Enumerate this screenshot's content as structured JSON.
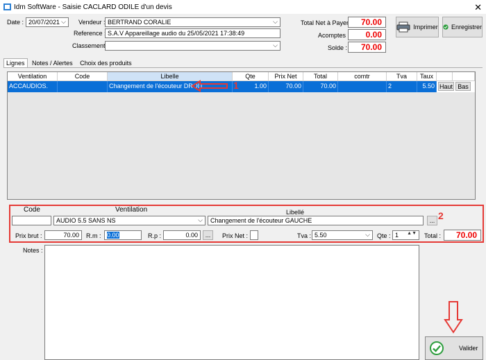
{
  "window": {
    "title": "Idm SoftWare - Saisie CACLARD ODILE d'un devis",
    "close": "✕"
  },
  "header": {
    "date_label": "Date :",
    "date_value": "20/07/2021",
    "vendeur_label": "Vendeur :",
    "vendeur_value": "BERTRAND CORALIE",
    "reference_label": "Reference :",
    "reference_value": "S.A.V Appareillage audio du 25/05/2021 17:38:49",
    "classement_label": "Classement :",
    "classement_value": ""
  },
  "totals": {
    "net_label": "Total Net à Payer :",
    "net_value": "70.00",
    "acomptes_label": "Acomptes :",
    "acomptes_value": "0.00",
    "solde_label": "Solde :",
    "solde_value": "70.00"
  },
  "toolbar": {
    "print_label": "Imprimer",
    "save_label": "Enregistrer"
  },
  "tabs": [
    "Lignes",
    "Notes / Alertes",
    "Choix des produits"
  ],
  "grid": {
    "columns": [
      "Ventilation",
      "Code",
      "Libelle",
      "Qte",
      "Prix Net",
      "Total",
      "comtr",
      "Tva",
      "Taux",
      "",
      ""
    ],
    "row": {
      "ventilation": "ACCAUDIOS.",
      "code": "",
      "libelle": "Changement de l'écouteur DROIT",
      "qte": "1.00",
      "prix_net": "70.00",
      "total": "70.00",
      "comtr": "",
      "tva": "2",
      "taux": "5.50",
      "haut": "Haut",
      "bas": "Bas"
    }
  },
  "annotations": {
    "one": "1",
    "two": "2"
  },
  "edit": {
    "code_label": "Code",
    "ventilation_label": "Ventilation",
    "libelle_label": "Libellé",
    "code_value": "",
    "ventilation_value": "AUDIO 5.5 SANS NS",
    "libelle_value": "Changement de l'écouteur GAUCHE",
    "ellipsis": "...",
    "prix_brut_label": "Prix brut :",
    "prix_brut_value": "70.00",
    "rm_label": "R.m :",
    "rm_value": "0.00",
    "rp_label": "R.p :",
    "rp_value": "0.00",
    "prix_net_label": "Prix Net :",
    "tva_label": "Tva :",
    "tva_value": "5.50",
    "qte_label": "Qte :",
    "qte_value": "1",
    "total_label": "Total :",
    "total_value": "70.00"
  },
  "notes": {
    "label": "Notes :",
    "value": ""
  },
  "valider_label": "Valider",
  "colors": {
    "selection": "#0a6fd7",
    "annotation": "#e53935",
    "money": "#e00000"
  }
}
